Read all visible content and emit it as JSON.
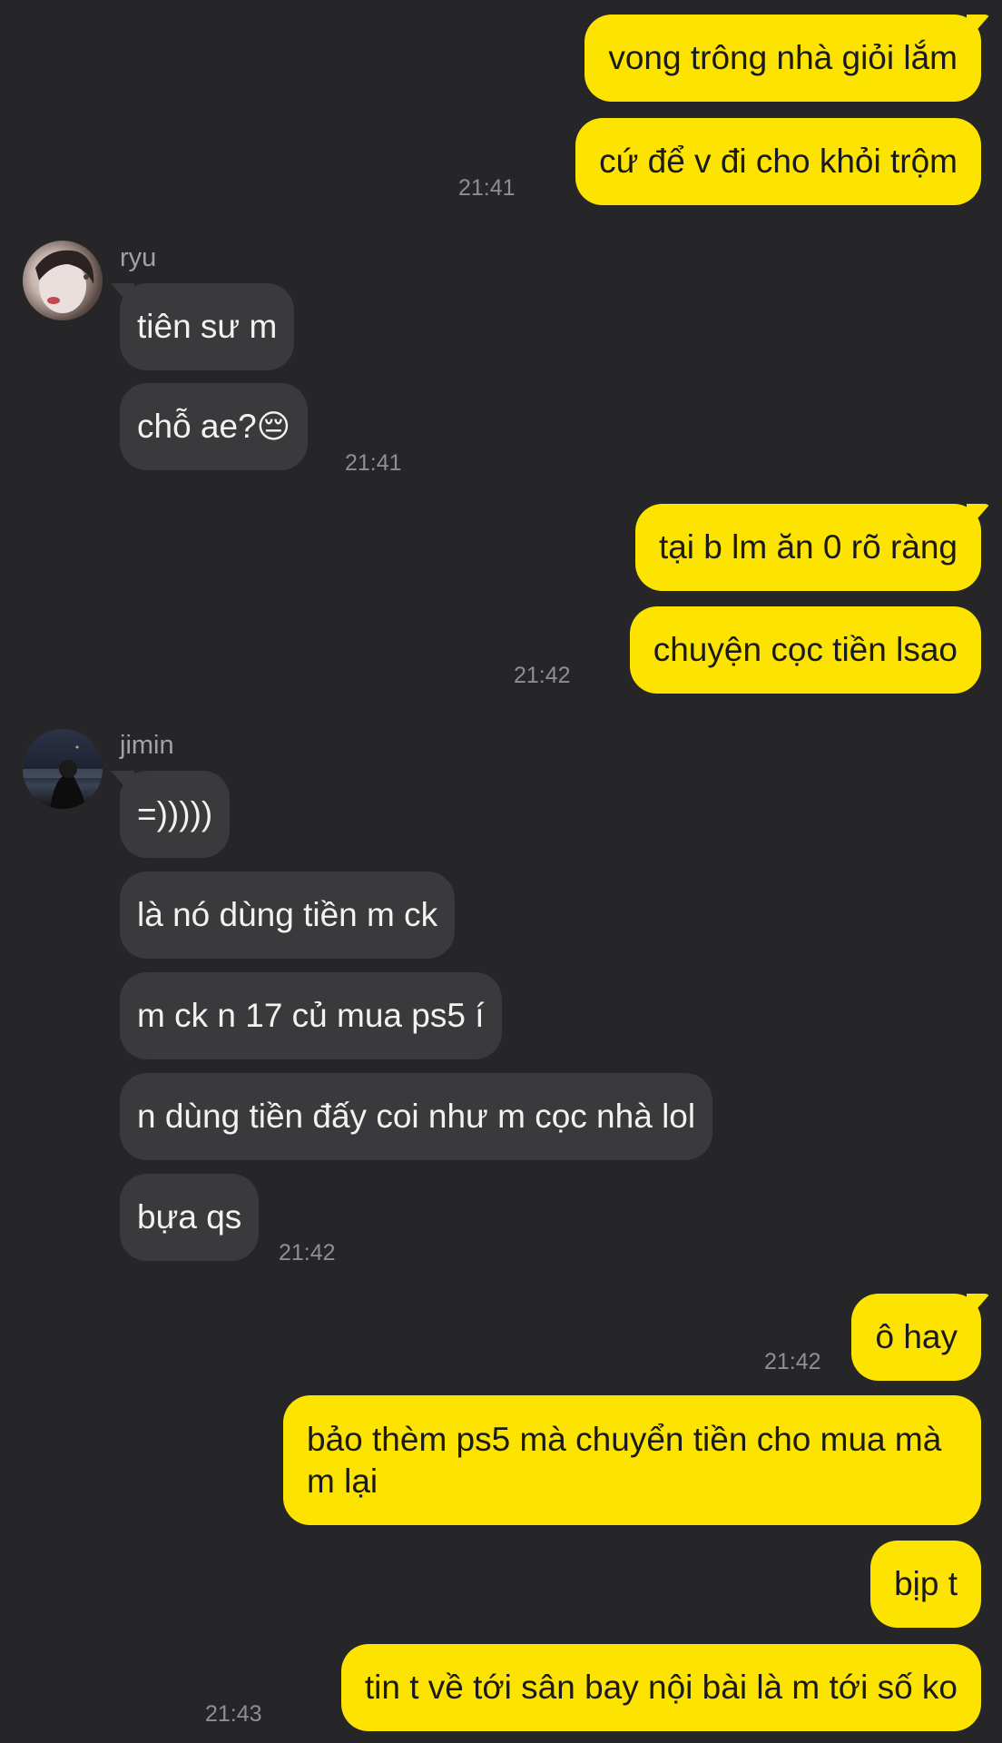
{
  "messages": {
    "m1": "vong trông nhà giỏi lắm",
    "m2": "cứ để v đi cho khỏi trộm",
    "t1": "21:41",
    "ryu_name": "ryu",
    "m3": "tiên sư m",
    "m4": "chỗ ae?",
    "m4_emoji": "😔",
    "t2": "21:41",
    "m5": "tại b lm ăn 0 rõ ràng",
    "m6": "chuyện cọc tiền lsao",
    "t3": "21:42",
    "jimin_name": "jimin",
    "m7": "=)))))",
    "m8": "là nó dùng tiền m ck",
    "m9": "m ck n 17 củ mua ps5 í",
    "m10": "n dùng tiền đấy coi như m cọc nhà lol",
    "m11": "bựa qs",
    "t4": "21:42",
    "m12": "ô hay",
    "t5": "21:42",
    "m13": "bảo thèm ps5 mà chuyển tiền cho mua mà m lại",
    "m14": "bịp t",
    "m15": "tin t về tới sân bay nội bài là m tới số ko",
    "t6": "21:43"
  },
  "colors": {
    "background": "#262628",
    "outgoing_bubble": "#fde400",
    "incoming_bubble": "#3a3a3c"
  },
  "icons": {
    "ryu_avatar": "avatar-ryu",
    "jimin_avatar": "avatar-jimin"
  }
}
